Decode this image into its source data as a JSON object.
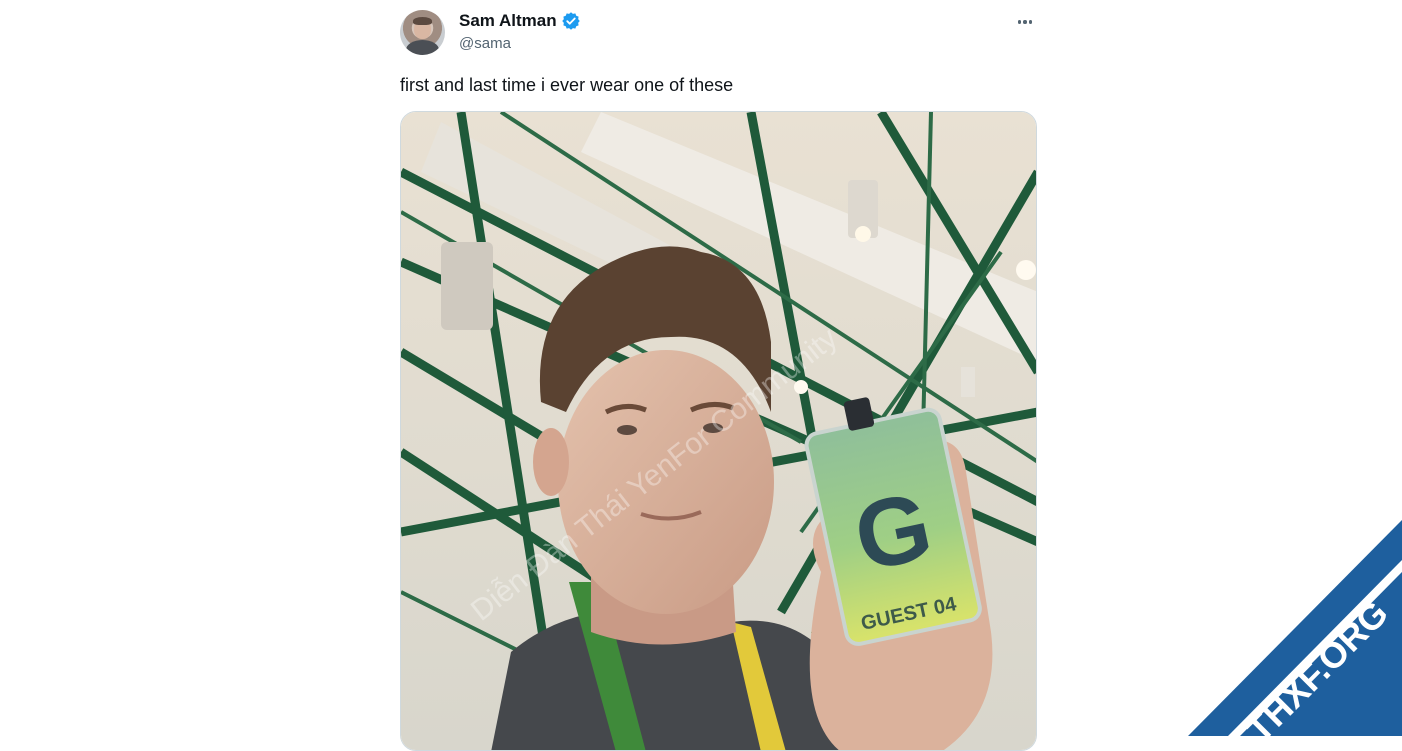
{
  "author": {
    "display_name": "Sam Altman",
    "handle": "@sama",
    "verified": true,
    "verified_color": "#1d9bf0"
  },
  "tweet": {
    "text": "first and last time i ever wear one of these"
  },
  "media": {
    "badge_label": "GUEST 04",
    "badge_letter": "G",
    "watermark_text": "Diễn Đàn Thái YenFor Community"
  },
  "corner_badge": {
    "text": "THXF.ORG",
    "color": "#1e5f9e",
    "accent": "#f39c12"
  },
  "icons": {
    "more": "more-horizontal-icon",
    "verified": "verified-check-icon"
  }
}
